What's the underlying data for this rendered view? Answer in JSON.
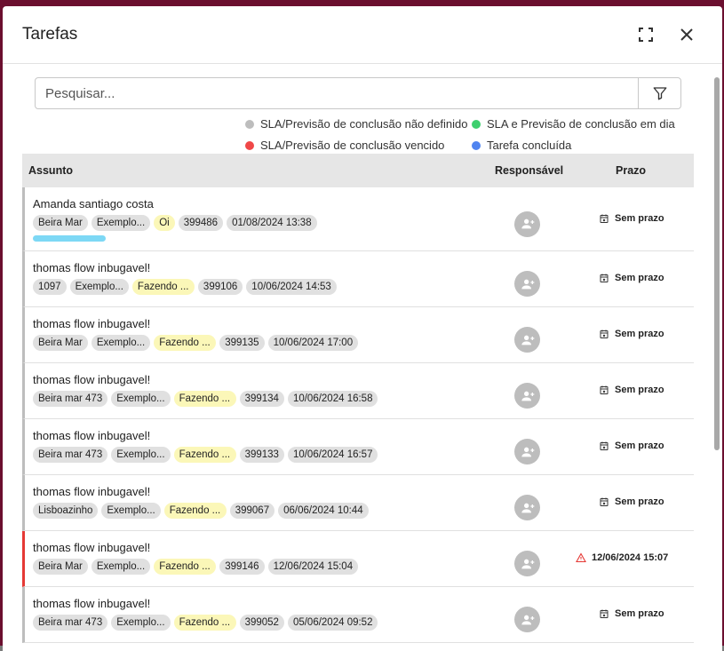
{
  "dialog": {
    "title": "Tarefas"
  },
  "search": {
    "placeholder": "Pesquisar..."
  },
  "legend": [
    {
      "label": "SLA/Previsão de conclusão não definido",
      "color": "#bdbdbd"
    },
    {
      "label": "SLA e Previsão de conclusão em dia",
      "color": "#3ecf6e"
    },
    {
      "label": "SLA/Previsão de conclusão vencido",
      "color": "#f04848"
    },
    {
      "label": "Tarefa concluída",
      "color": "#4f84f0"
    }
  ],
  "table": {
    "headers": {
      "subject": "Assunto",
      "responsible": "Responsável",
      "deadline": "Prazo"
    },
    "rows": [
      {
        "title": "Amanda santiago costa",
        "chips": [
          "Beira Mar",
          "Exemplo...",
          "Oi",
          "399486",
          "01/08/2024 13:38"
        ],
        "status_index": 2,
        "deadline": "Sem prazo",
        "deadline_icon": "calendar-icon",
        "progress": 1.0
      },
      {
        "title": "thomas flow inbugavel!",
        "chips": [
          "1097",
          "Exemplo...",
          "Fazendo ...",
          "399106",
          "10/06/2024 14:53"
        ],
        "status_index": 2,
        "deadline": "Sem prazo",
        "deadline_icon": "calendar-icon"
      },
      {
        "title": "thomas flow inbugavel!",
        "chips": [
          "Beira Mar",
          "Exemplo...",
          "Fazendo ...",
          "399135",
          "10/06/2024 17:00"
        ],
        "status_index": 2,
        "deadline": "Sem prazo",
        "deadline_icon": "calendar-icon"
      },
      {
        "title": "thomas flow inbugavel!",
        "chips": [
          "Beira mar 473",
          "Exemplo...",
          "Fazendo ...",
          "399134",
          "10/06/2024 16:58"
        ],
        "status_index": 2,
        "deadline": "Sem prazo",
        "deadline_icon": "calendar-icon"
      },
      {
        "title": "thomas flow inbugavel!",
        "chips": [
          "Beira mar 473",
          "Exemplo...",
          "Fazendo ...",
          "399133",
          "10/06/2024 16:57"
        ],
        "status_index": 2,
        "deadline": "Sem prazo",
        "deadline_icon": "calendar-icon"
      },
      {
        "title": "thomas flow inbugavel!",
        "chips": [
          "Lisboazinho",
          "Exemplo...",
          "Fazendo ...",
          "399067",
          "06/06/2024 10:44"
        ],
        "status_index": 2,
        "deadline": "Sem prazo",
        "deadline_icon": "calendar-icon"
      },
      {
        "title": "thomas flow inbugavel!",
        "chips": [
          "Beira Mar",
          "Exemplo...",
          "Fazendo ...",
          "399146",
          "12/06/2024 15:04"
        ],
        "status_index": 2,
        "deadline": "12/06/2024 15:07",
        "deadline_icon": "warning-icon",
        "overdue": true
      },
      {
        "title": "thomas flow inbugavel!",
        "chips": [
          "Beira mar 473",
          "Exemplo...",
          "Fazendo ...",
          "399052",
          "05/06/2024 09:52"
        ],
        "status_index": 2,
        "deadline": "Sem prazo",
        "deadline_icon": "calendar-icon"
      }
    ]
  }
}
